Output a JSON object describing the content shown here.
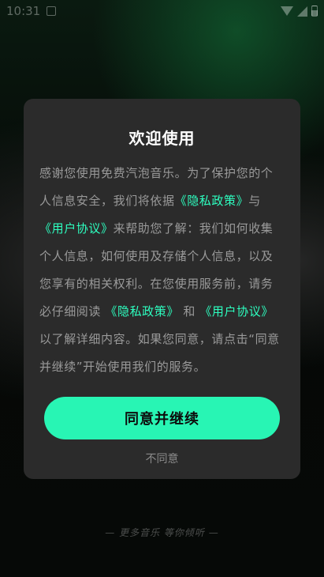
{
  "status_bar": {
    "time": "10:31"
  },
  "dialog": {
    "title": "欢迎使用",
    "body": [
      {
        "text": "感谢您使用免费汽泡音乐。为了保护您的个人信息安全，我们将依据",
        "link": false
      },
      {
        "text": "《隐私政策》",
        "link": true
      },
      {
        "text": "与",
        "link": false
      },
      {
        "text": "《用户协议》",
        "link": true
      },
      {
        "text": "来帮助您了解：我们如何收集个人信息，如何使用及存储个人信息，以及您享有的相关权利。在您使用服务前，请务必仔细阅读 ",
        "link": false
      },
      {
        "text": "《隐私政策》",
        "link": true
      },
      {
        "text": " 和 ",
        "link": false
      },
      {
        "text": "《用户协议》",
        "link": true
      },
      {
        "text": "以了解详细内容。如果您同意，请点击“同意并继续”开始使用我们的服务。",
        "link": false
      }
    ],
    "agree_label": "同意并继续",
    "disagree_label": "不同意"
  },
  "slogan": "— 更多音乐 等你倾听 —",
  "colors": {
    "accent": "#28f5b4",
    "link": "#2dffc0",
    "dialog_bg": "#2b2b2b"
  }
}
